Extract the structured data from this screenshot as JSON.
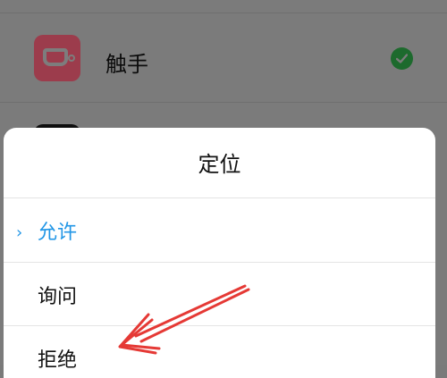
{
  "background_list": {
    "app_name": "触手",
    "status_color": "#1d6a2d"
  },
  "dialog": {
    "title": "定位",
    "options": [
      {
        "label": "允许",
        "selected": true,
        "indicator": "›"
      },
      {
        "label": "询问",
        "selected": false
      },
      {
        "label": "拒绝",
        "selected": false
      }
    ],
    "accent_color": "#2196e6"
  },
  "annotation": {
    "arrow_color": "#e53935",
    "points_to": "拒绝"
  }
}
